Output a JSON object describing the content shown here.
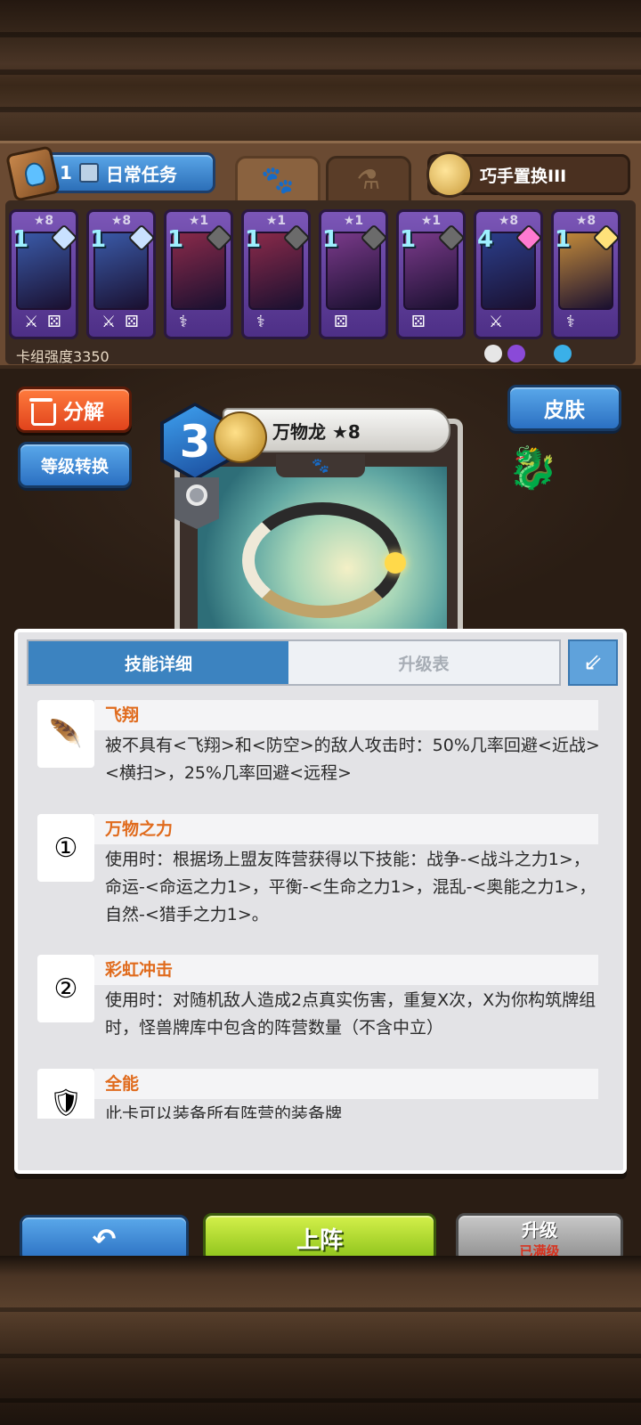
{
  "header": {
    "quest_count": "1",
    "quest_label": "日常任务",
    "swap_label": "巧手置换III",
    "tabs": [
      "paw-icon",
      "potion-icon"
    ]
  },
  "deck": {
    "cards": [
      {
        "stars": "★8",
        "cost": "1",
        "faction_color": "#c9e1ff",
        "art": "#3a5aa8",
        "eq": [
          "sword-icon",
          "dice-icon"
        ]
      },
      {
        "stars": "★8",
        "cost": "1",
        "faction_color": "#c9e1ff",
        "art": "#3a5aa8",
        "eq": [
          "sword-icon",
          "dice-icon"
        ]
      },
      {
        "stars": "★1",
        "cost": "1",
        "faction_color": "#6b6b6b",
        "art": "#8a2a4a",
        "eq": [
          "staff-icon"
        ]
      },
      {
        "stars": "★1",
        "cost": "1",
        "faction_color": "#6b6b6b",
        "art": "#8a2a4a",
        "eq": [
          "staff-icon"
        ]
      },
      {
        "stars": "★1",
        "cost": "1",
        "faction_color": "#6b6b6b",
        "art": "#7a3a8a",
        "eq": [
          "dice-icon"
        ]
      },
      {
        "stars": "★1",
        "cost": "1",
        "faction_color": "#6b6b6b",
        "art": "#7a3a8a",
        "eq": [
          "dice-icon"
        ]
      },
      {
        "stars": "★8",
        "cost": "4",
        "faction_color": "#ff7ad1",
        "art": "#2b3e8a",
        "eq": [
          "sword-icon"
        ]
      },
      {
        "stars": "★8",
        "cost": "1",
        "faction_color": "#ffe27a",
        "art": "#c28a3a",
        "eq": [
          "staff-icon"
        ]
      }
    ],
    "strength_label": "卡组强度3350",
    "faction_colors": [
      "#e6e6e6",
      "#8a4ad8",
      "#3a2a20",
      "#3ab0e8",
      "#3a2a20",
      "#3a2a20"
    ]
  },
  "actions": {
    "disassemble": "分解",
    "level_convert": "等级转换",
    "skin": "皮肤"
  },
  "card": {
    "cost": "3",
    "name": "万物龙 ★8"
  },
  "details": {
    "tab_active": "技能详细",
    "tab_inactive": "升级表",
    "skills": [
      {
        "icon": "feather-icon",
        "title": "飞翔",
        "desc": "被不具有<飞翔>和<防空>的敌人攻击时：50%几率回避<近战><横扫>，25%几率回避<远程>"
      },
      {
        "icon": "rainbow-1-icon",
        "title": "万物之力",
        "desc": "使用时：根据场上盟友阵营获得以下技能：战争-<战斗之力1>，命运-<命运之力1>，平衡-<生命之力1>，混乱-<奥能之力1>，自然-<猎手之力1>。"
      },
      {
        "icon": "rainbow-2-icon",
        "title": "彩虹冲击",
        "desc": "使用时：对随机敌人造成2点真实伤害，重复X次，X为你构筑牌组时，怪兽牌库中包含的阵营数量（不含中立）"
      },
      {
        "icon": "shield-icon",
        "title": "全能",
        "desc": "此卡可以装备所有阵营的装备牌"
      }
    ]
  },
  "bottom": {
    "deploy": "上阵",
    "upgrade": "升级",
    "upgrade_status": "已满级"
  }
}
